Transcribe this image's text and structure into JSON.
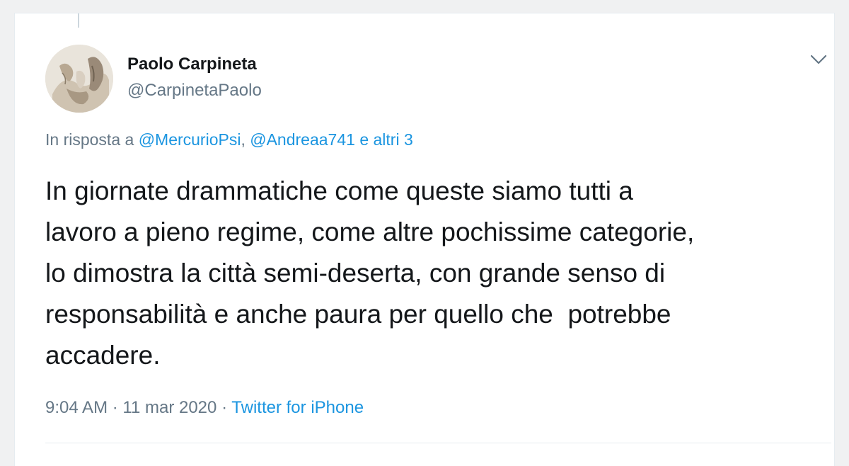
{
  "author": {
    "display_name": "Paolo Carpineta",
    "handle": "@CarpinetaPaolo"
  },
  "reply": {
    "prefix": "In risposta a",
    "mention_1": "@MercurioPsi",
    "separator": ",",
    "mention_2": "@Andreaa741",
    "others": "e altri 3"
  },
  "tweet": {
    "text": "In giornate drammatiche come queste siamo tutti a\nlavoro a pieno regime, come altre pochissime categorie,\nlo dimostra la città semi-deserta, con grande senso di\nresponsabilità e anche paura per quello che  potrebbe\naccadere."
  },
  "meta": {
    "time": "9:04 AM",
    "dot": "·",
    "date": "11 mar 2020",
    "source": "Twitter for iPhone"
  },
  "icons": {
    "menu": "chevron-down-icon"
  },
  "colors": {
    "text": "#14171a",
    "secondary": "#657786",
    "link": "#1b95e0",
    "border": "#e6ecf0"
  }
}
